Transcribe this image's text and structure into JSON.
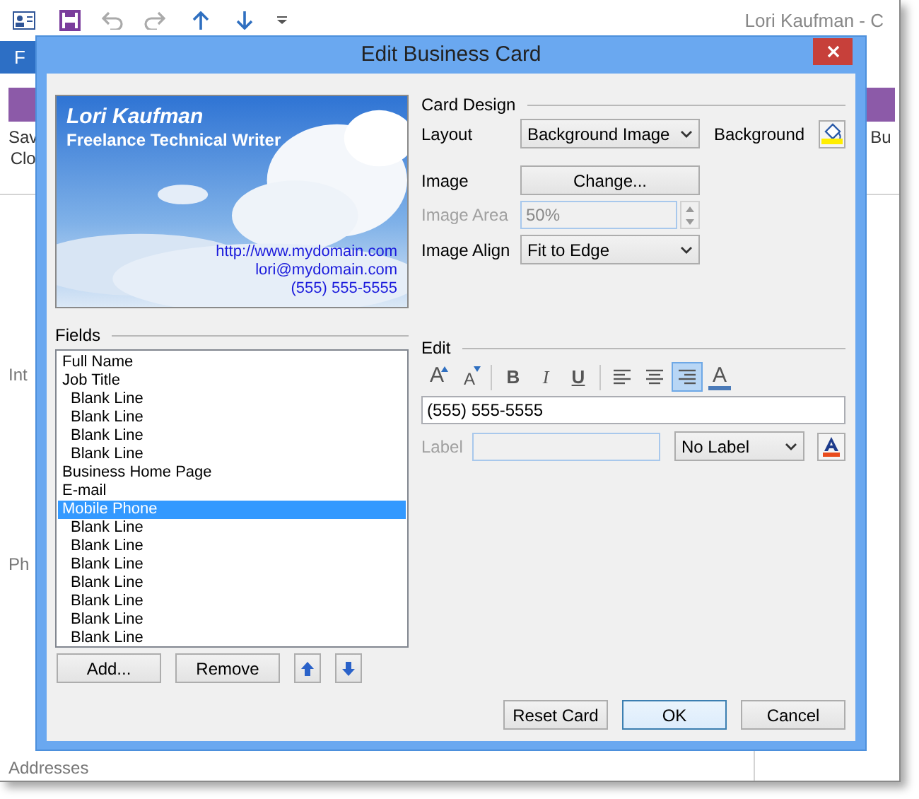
{
  "background_window": {
    "title": "Lori Kaufman - C",
    "file_tab": "F",
    "ribbon_buttons": [
      {
        "lines": [
          "Sav",
          "Clo"
        ]
      },
      {
        "lines": [
          "Bu"
        ]
      }
    ],
    "side_labels": [
      "Int",
      "Ph",
      "Addresses"
    ]
  },
  "dialog": {
    "title": "Edit Business Card",
    "card": {
      "name": "Lori Kaufman",
      "job_title": "Freelance Technical Writer",
      "contact_lines": [
        "http://www.mydomain.com",
        "lori@mydomain.com",
        "(555) 555-5555"
      ]
    },
    "fields_heading": "Fields",
    "fields": [
      {
        "label": "Full Name",
        "kind": "field",
        "selected": false
      },
      {
        "label": "Job Title",
        "kind": "field",
        "selected": false
      },
      {
        "label": "Blank Line",
        "kind": "blank",
        "selected": false
      },
      {
        "label": "Blank Line",
        "kind": "blank",
        "selected": false
      },
      {
        "label": "Blank Line",
        "kind": "blank",
        "selected": false
      },
      {
        "label": "Blank Line",
        "kind": "blank",
        "selected": false
      },
      {
        "label": "Business Home Page",
        "kind": "field",
        "selected": false
      },
      {
        "label": "E-mail",
        "kind": "field",
        "selected": false
      },
      {
        "label": "Mobile Phone",
        "kind": "field",
        "selected": true
      },
      {
        "label": "Blank Line",
        "kind": "blank",
        "selected": false
      },
      {
        "label": "Blank Line",
        "kind": "blank",
        "selected": false
      },
      {
        "label": "Blank Line",
        "kind": "blank",
        "selected": false
      },
      {
        "label": "Blank Line",
        "kind": "blank",
        "selected": false
      },
      {
        "label": "Blank Line",
        "kind": "blank",
        "selected": false
      },
      {
        "label": "Blank Line",
        "kind": "blank",
        "selected": false
      },
      {
        "label": "Blank Line",
        "kind": "blank",
        "selected": false
      }
    ],
    "field_buttons": {
      "add": "Add...",
      "remove": "Remove"
    },
    "card_design": {
      "heading": "Card Design",
      "layout_label": "Layout",
      "layout_value": "Background Image",
      "background_label": "Background",
      "image_label": "Image",
      "change_button": "Change...",
      "image_area_label": "Image Area",
      "image_area_value": "50%",
      "image_area_disabled": true,
      "image_align_label": "Image Align",
      "image_align_value": "Fit to Edge"
    },
    "edit": {
      "heading": "Edit",
      "toolbar": [
        {
          "kind": "grow",
          "label": "A",
          "selected": false
        },
        {
          "kind": "shrink",
          "label": "A",
          "selected": false
        },
        {
          "kind": "separator"
        },
        {
          "kind": "bold",
          "label": "B",
          "selected": false
        },
        {
          "kind": "italic",
          "label": "I",
          "selected": false
        },
        {
          "kind": "underline",
          "label": "U",
          "selected": false
        },
        {
          "kind": "separator"
        },
        {
          "kind": "align-left",
          "selected": false
        },
        {
          "kind": "align-center",
          "selected": false
        },
        {
          "kind": "align-right",
          "selected": true
        },
        {
          "kind": "font-color",
          "label": "A",
          "selected": false
        }
      ],
      "text_value": "(555) 555-5555",
      "label_label": "Label",
      "label_disabled": true,
      "label_select": "No Label"
    },
    "buttons": {
      "reset": "Reset Card",
      "ok": "OK",
      "cancel": "Cancel"
    }
  }
}
